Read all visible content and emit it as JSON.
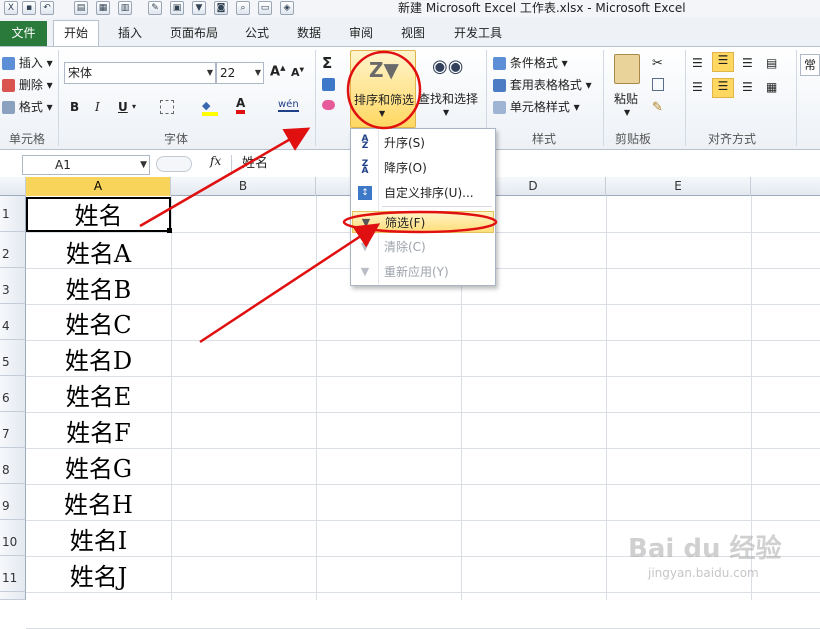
{
  "window": {
    "title": "新建 Microsoft Excel 工作表.xlsx  -  Microsoft Excel"
  },
  "tabs": {
    "file": "文件",
    "home": "开始",
    "insert": "插入",
    "page_layout": "页面布局",
    "formulas": "公式",
    "data": "数据",
    "review": "审阅",
    "view": "视图",
    "developer": "开发工具"
  },
  "ribbon": {
    "cells_group": {
      "insert": "插入",
      "delete": "删除",
      "format": "格式",
      "label": "单元格"
    },
    "font_group": {
      "font_name": "宋体",
      "font_size": "22",
      "bold": "B",
      "italic": "I",
      "underline": "U",
      "font_color": "A",
      "phonetic": "wén",
      "label": "字体"
    },
    "editing_group": {
      "sum": "Σ",
      "sort_filter": "排序和筛选",
      "find_select": "查找和选择"
    },
    "styles_group": {
      "conditional": "条件格式",
      "table_format": "套用表格格式",
      "cell_styles": "单元格样式",
      "label": "样式"
    },
    "clipboard_group": {
      "paste": "粘贴",
      "label": "剪贴板"
    },
    "alignment_group": {
      "label": "对齐方式",
      "partial": "常"
    }
  },
  "formula_bar": {
    "name_box": "A1",
    "fx": "fx",
    "content": "姓名"
  },
  "columns": [
    "A",
    "B",
    "C",
    "D",
    "E"
  ],
  "rows": [
    {
      "num": "1",
      "a": "姓名"
    },
    {
      "num": "2",
      "a": "姓名A"
    },
    {
      "num": "3",
      "a": "姓名B"
    },
    {
      "num": "4",
      "a": "姓名C"
    },
    {
      "num": "5",
      "a": "姓名D"
    },
    {
      "num": "6",
      "a": "姓名E"
    },
    {
      "num": "7",
      "a": "姓名F"
    },
    {
      "num": "8",
      "a": "姓名G"
    },
    {
      "num": "9",
      "a": "姓名H"
    },
    {
      "num": "10",
      "a": "姓名I"
    },
    {
      "num": "11",
      "a": "姓名J"
    }
  ],
  "sort_menu": {
    "ascending": "升序(S)",
    "descending": "降序(O)",
    "custom": "自定义排序(U)...",
    "filter": "筛选(F)",
    "clear": "清除(C)",
    "reapply": "重新应用(Y)"
  },
  "watermark": {
    "brand": "Bai du 经验",
    "url": "jingyan.baidu.com"
  },
  "colors": {
    "file_tab": "#2a7a3b",
    "highlight": "#ffd862",
    "annotation": "#e01010",
    "selected_header": "#f8d45a"
  }
}
